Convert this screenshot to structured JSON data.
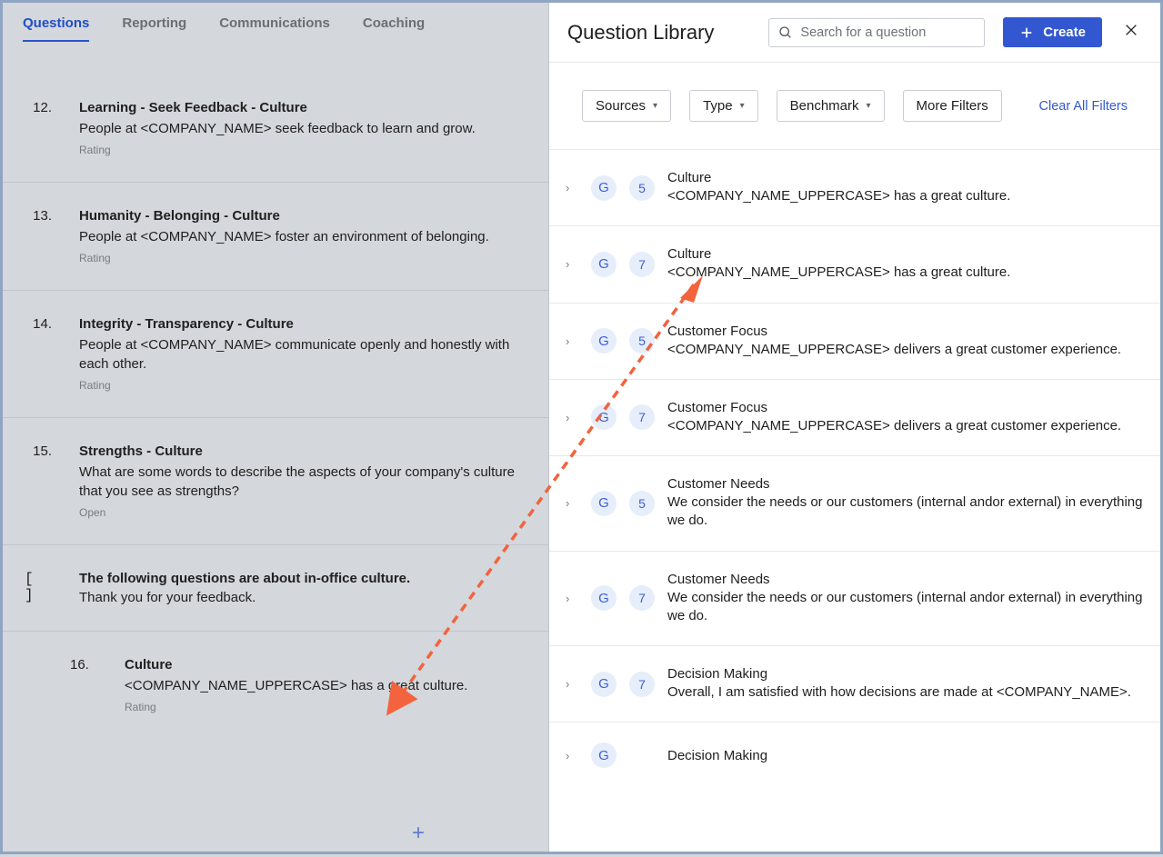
{
  "tabs": {
    "questions": "Questions",
    "reporting": "Reporting",
    "communications": "Communications",
    "coaching": "Coaching"
  },
  "questions_list": [
    {
      "num": "12.",
      "title": "Learning - Seek Feedback - Culture",
      "desc": "People at <COMPANY_NAME> seek feedback to learn and grow.",
      "type": "Rating"
    },
    {
      "num": "13.",
      "title": "Humanity - Belonging - Culture",
      "desc": "People at <COMPANY_NAME> foster an environment of belonging.",
      "type": "Rating"
    },
    {
      "num": "14.",
      "title": "Integrity - Transparency - Culture",
      "desc": "People at <COMPANY_NAME> communicate openly and honestly with each other.",
      "type": "Rating"
    },
    {
      "num": "15.",
      "title": "Strengths - Culture",
      "desc": "What are some words to describe the aspects of your company's culture that you see as strengths?",
      "type": "Open"
    }
  ],
  "section": {
    "icon": "[ ]",
    "title": "The following questions are about in-office culture.",
    "sub": "Thank you for your feedback."
  },
  "q16": {
    "num": "16.",
    "title": "Culture",
    "desc": "<COMPANY_NAME_UPPERCASE> has a great culture.",
    "type": "Rating"
  },
  "panel": {
    "title": "Question Library",
    "search_placeholder": "Search for a question",
    "create": "Create"
  },
  "filters": {
    "sources": "Sources",
    "type": "Type",
    "benchmark": "Benchmark",
    "more": "More Filters",
    "clear": "Clear All Filters"
  },
  "library": [
    {
      "badge": "G",
      "num": "5",
      "cat": "Culture",
      "desc": "<COMPANY_NAME_UPPERCASE> has a great culture."
    },
    {
      "badge": "G",
      "num": "7",
      "cat": "Culture",
      "desc": "<COMPANY_NAME_UPPERCASE> has a great culture."
    },
    {
      "badge": "G",
      "num": "5",
      "cat": "Customer Focus",
      "desc": "<COMPANY_NAME_UPPERCASE> delivers a great customer experience."
    },
    {
      "badge": "G",
      "num": "7",
      "cat": "Customer Focus",
      "desc": "<COMPANY_NAME_UPPERCASE> delivers a great customer experience."
    },
    {
      "badge": "G",
      "num": "5",
      "cat": "Customer Needs",
      "desc": "We consider the needs or our customers (internal andor external) in everything we do."
    },
    {
      "badge": "G",
      "num": "7",
      "cat": "Customer Needs",
      "desc": "We consider the needs or our customers (internal andor external) in everything we do."
    },
    {
      "badge": "G",
      "num": "7",
      "cat": "Decision Making",
      "desc": "Overall, I am satisfied with how decisions are made at <COMPANY_NAME>."
    },
    {
      "badge": "G",
      "num": "",
      "cat": "Decision Making",
      "desc": ""
    }
  ]
}
